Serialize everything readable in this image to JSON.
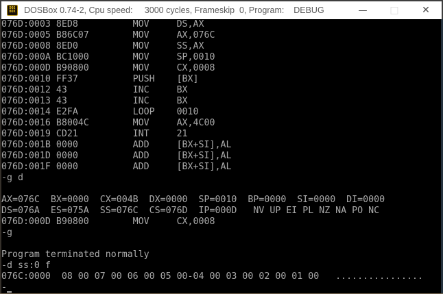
{
  "window": {
    "title": "DOSBox 0.74-2, Cpu speed:     3000 cycles, Frameskip  0, Program:    DEBUG",
    "icon": {
      "name": "dosbox-logo-icon",
      "text_top": "DOS",
      "text_bottom": "BOX"
    },
    "controls": {
      "minimize_glyph": "—",
      "maximize_glyph": "□",
      "close_glyph": "✕"
    }
  },
  "colors": {
    "titlebar_bg": "#ffffff",
    "title_text": "#595959",
    "terminal_bg": "#000000",
    "terminal_text": "#aaaaaa",
    "icon_gold": "#f2c51d",
    "border_bottom": "#7a6b55"
  },
  "terminal": {
    "lines": [
      "076D:0003 8ED8          MOV     DS,AX",
      "076D:0005 B86C07        MOV     AX,076C",
      "076D:0008 8ED0          MOV     SS,AX",
      "076D:000A BC1000        MOV     SP,0010",
      "076D:000D B90800        MOV     CX,0008",
      "076D:0010 FF37          PUSH    [BX]",
      "076D:0012 43            INC     BX",
      "076D:0013 43            INC     BX",
      "076D:0014 E2FA          LOOP    0010",
      "076D:0016 B8004C        MOV     AX,4C00",
      "076D:0019 CD21          INT     21",
      "076D:001B 0000          ADD     [BX+SI],AL",
      "076D:001D 0000          ADD     [BX+SI],AL",
      "076D:001F 0000          ADD     [BX+SI],AL",
      "-g d",
      "",
      "AX=076C  BX=0000  CX=004B  DX=0000  SP=0010  BP=0000  SI=0000  DI=0000",
      "DS=076A  ES=075A  SS=076C  CS=076D  IP=000D   NV UP EI PL NZ NA PO NC",
      "076D:000D B90800        MOV     CX,0008",
      "-g",
      "",
      "Program terminated normally",
      "-d ss:0 f",
      "076C:0000  08 00 07 00 06 00 05 00-04 00 03 00 02 00 01 00   ................",
      "-"
    ],
    "cursor": {
      "row": 24,
      "col": 1
    }
  }
}
